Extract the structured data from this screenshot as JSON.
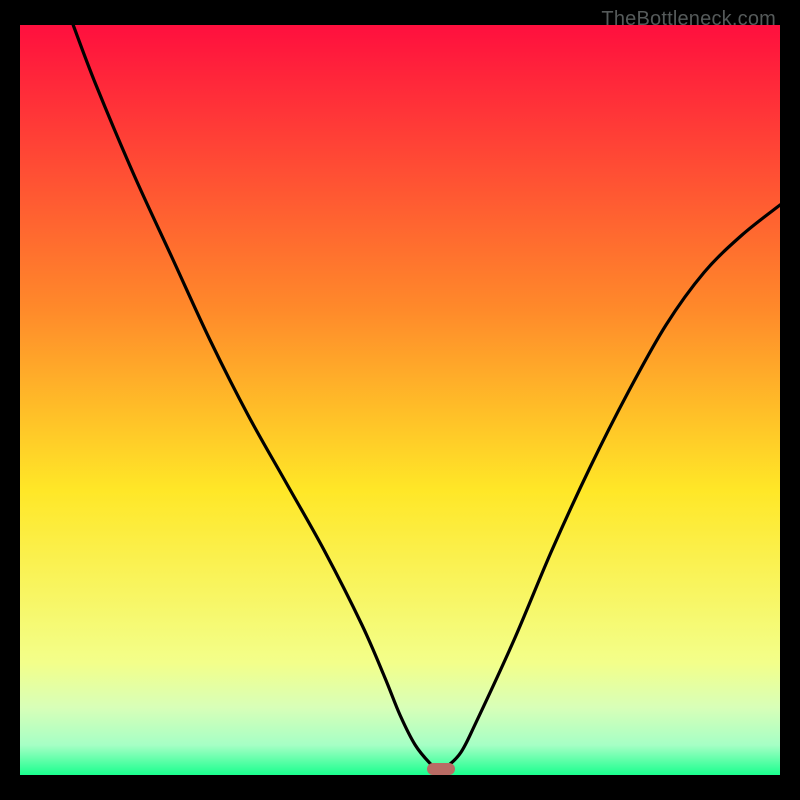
{
  "watermark": "TheBottleneck.com",
  "colors": {
    "top": "#ff0f3e",
    "upper_mid": "#ff8a2a",
    "mid": "#ffe727",
    "lower1": "#f3ff8a",
    "lower2": "#d8ffb8",
    "lower3": "#a6ffc5",
    "bottom": "#1aff8e",
    "curve": "#010100",
    "marker": "#b96b64",
    "frame": "#000000"
  },
  "chart_data": {
    "type": "line",
    "title": "",
    "xlabel": "",
    "ylabel": "",
    "xlim": [
      0,
      100
    ],
    "ylim": [
      0,
      100
    ],
    "grid": false,
    "legend": false,
    "series": [
      {
        "name": "bottleneck-curve",
        "x": [
          7,
          10,
          15,
          20,
          25,
          30,
          35,
          40,
          45,
          48,
          50,
          52,
          54,
          55,
          56,
          58,
          60,
          65,
          70,
          75,
          80,
          85,
          90,
          95,
          100
        ],
        "y": [
          100,
          92,
          80,
          69,
          58,
          48,
          39,
          30,
          20,
          13,
          8,
          4,
          1.5,
          0.8,
          1.0,
          3,
          7,
          18,
          30,
          41,
          51,
          60,
          67,
          72,
          76
        ]
      }
    ],
    "marker": {
      "x": 55.4,
      "y": 0.8
    },
    "notch_x_fraction": 0.554,
    "background_gradient_stops": [
      {
        "pos": 0.0,
        "color": "#ff0f3e"
      },
      {
        "pos": 0.38,
        "color": "#ff8a2a"
      },
      {
        "pos": 0.62,
        "color": "#ffe727"
      },
      {
        "pos": 0.85,
        "color": "#f3ff8a"
      },
      {
        "pos": 0.91,
        "color": "#d8ffb8"
      },
      {
        "pos": 0.96,
        "color": "#a6ffc5"
      },
      {
        "pos": 1.0,
        "color": "#1aff8e"
      }
    ]
  }
}
